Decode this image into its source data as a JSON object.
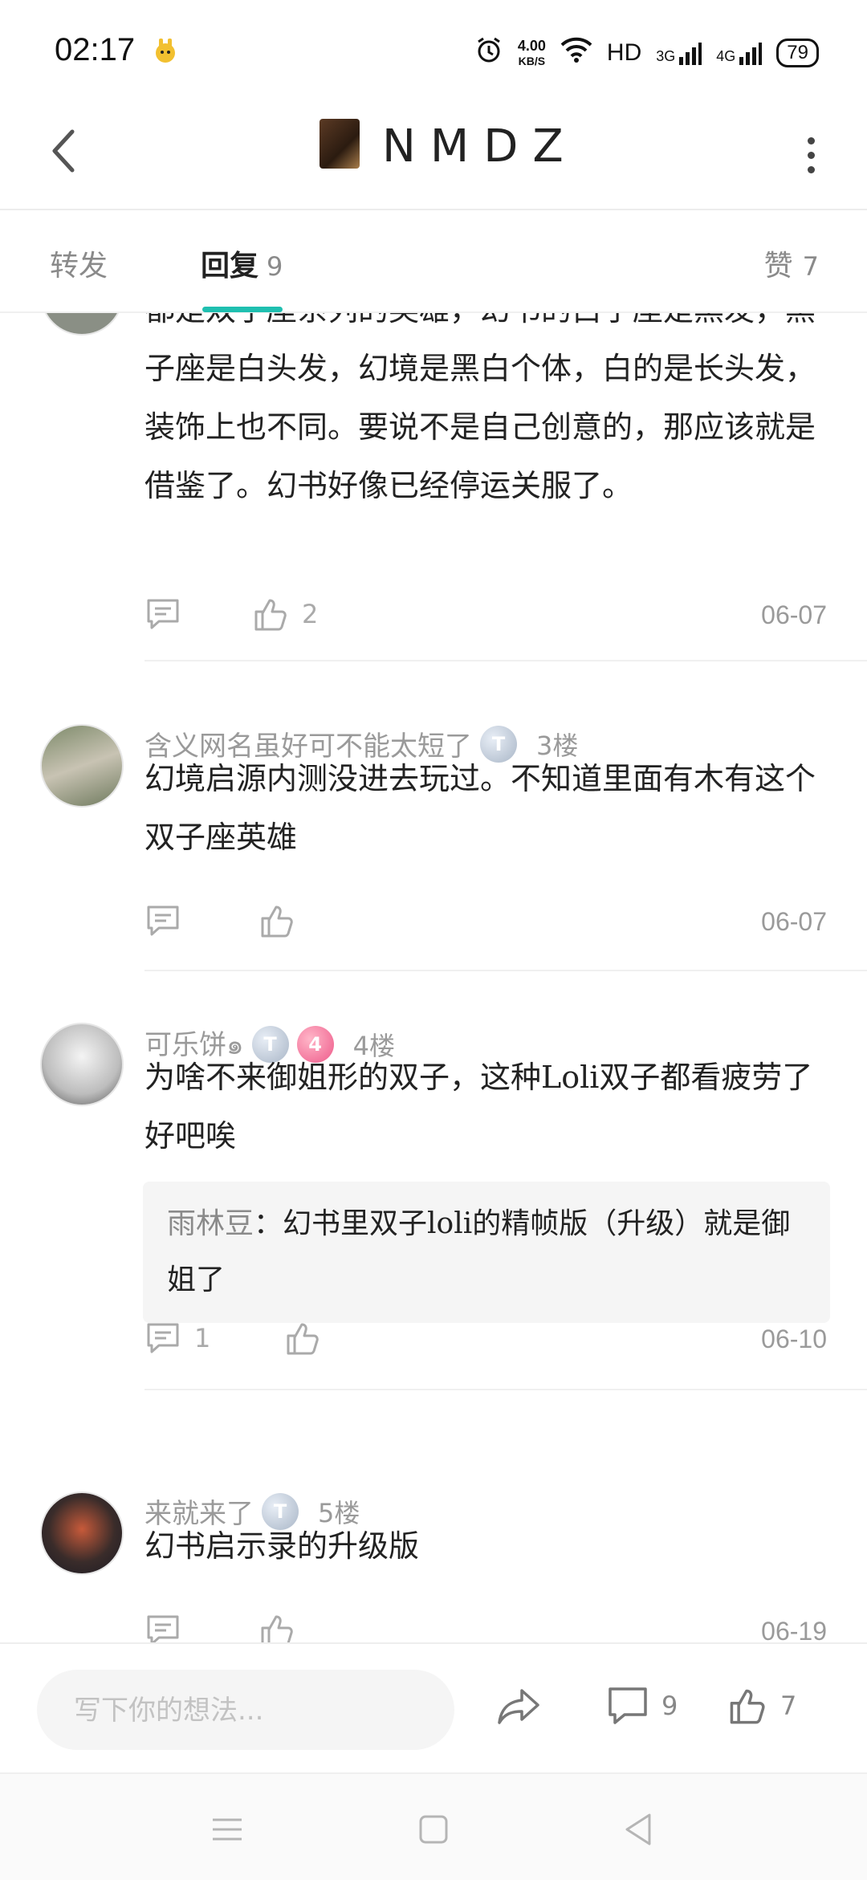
{
  "status_bar": {
    "time": "02:17",
    "speed_value": "4.00",
    "speed_unit": "KB/S",
    "hd": "HD",
    "net1": "3G",
    "net2": "4G",
    "battery": "79"
  },
  "header": {
    "title": "NMDZ",
    "back_icon": "chevron-left-icon",
    "more_icon": "more-vertical-icon"
  },
  "tabs": {
    "forward_label": "转发",
    "reply_label": "回复",
    "reply_count": "9",
    "like_label": "赞",
    "like_count": "7",
    "accent": "#1fbfb0"
  },
  "comments": [
    {
      "text": "都是双子座系列的英雄，幻书的白子座是黑发，黑子座是白头发，幻境是黑白个体，白的是长头发，装饰上也不同。要说不是自己创意的，那应该就是借鉴了。幻书好像已经停运关服了。",
      "like_count": "2",
      "date": "06-07"
    },
    {
      "username": "含义网名虽好可不能太短了",
      "badge1": "T",
      "floor": "3楼",
      "text": "幻境启源内测没进去玩过。不知道里面有木有这个双子座英雄",
      "date": "06-07"
    },
    {
      "username": "可乐饼๑",
      "badge1": "T",
      "badge2": "4",
      "floor": "4楼",
      "text": "为啥不来御姐形的双子，这种Loli双子都看疲劳了好吧唉",
      "quote_name": "雨林豆",
      "quote_text": "幻书里双子loli的精帧版（升级）就是御姐了",
      "reply_count": "1",
      "date": "06-10"
    },
    {
      "username": "来就来了",
      "badge1": "T",
      "floor": "5楼",
      "text": "幻书启示录的升级版",
      "date": "06-19"
    }
  ],
  "bottom_bar": {
    "placeholder": "写下你的想法...",
    "comment_count": "9",
    "like_count": "7"
  }
}
